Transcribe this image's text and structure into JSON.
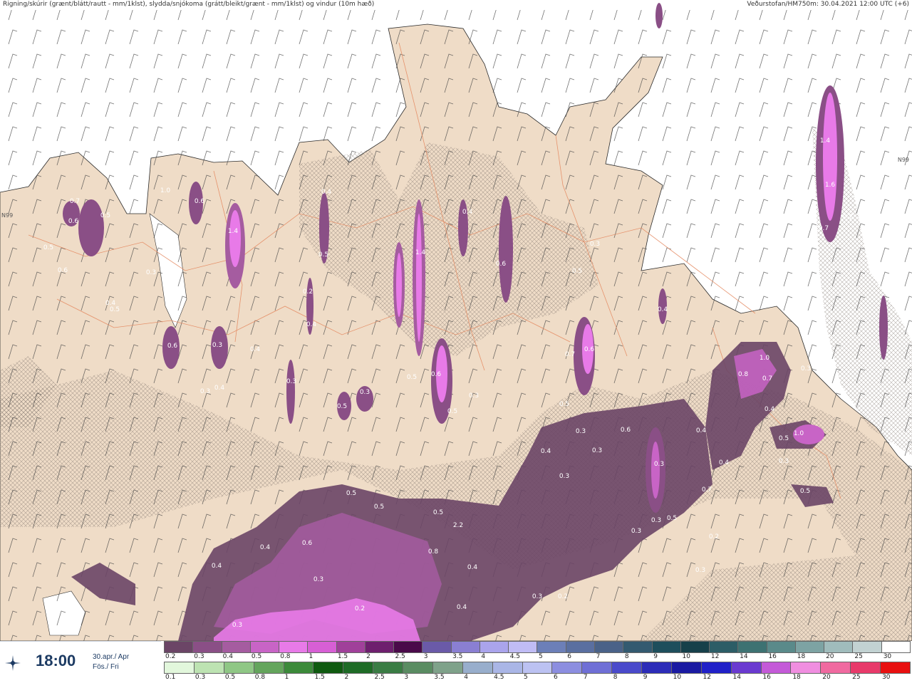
{
  "header": {
    "left_text": "Rigning/skúrir (grænt/blátt/rautt - mm/1klst), slydda/snjókoma (grátt/bleikt/grænt - mm/1klst) og vindur (10m hæð)",
    "right_text": "Veðurstofan/HM750m: 30.04.2021 12:00 UTC (+6)"
  },
  "lat_labels": {
    "left": "N99",
    "right": "N99"
  },
  "time_panel": {
    "time": "18:00",
    "date_line1": "30.apr./ Apr",
    "date_line2": "Fös./ Fri",
    "icon": "sun-compass-icon"
  },
  "precip_labels": [
    "0.7",
    "0.5",
    "0.6",
    "0.5",
    "0.6",
    "1.0",
    "0.6",
    "1.4",
    "0.3",
    "0.4",
    "0.3",
    "0.4",
    "1.4",
    "0.4",
    "0.5",
    "0.2",
    "0.4",
    "0.6",
    "0.5",
    "0.3",
    "0.3",
    "0.5",
    "0.5",
    "0.6",
    "0.5",
    "0.3",
    "0.6",
    "0.5",
    "0.3",
    "0.4",
    "0.3",
    "0.4",
    "0.7",
    "0.8",
    "1.0",
    "0.7",
    "0.3",
    "1.4",
    "1.6",
    "0.2",
    "0.7",
    "0.4",
    "1.0",
    "0.5",
    "0.3",
    "0.5",
    "0.2",
    "0.3",
    "0.4",
    "0.6",
    "0.5",
    "0.3",
    "0.4",
    "0.3",
    "0.4",
    "0.6",
    "0.3",
    "0.4",
    "0.7",
    "0.3",
    "0.5",
    "0.3",
    "0.3",
    "2.2",
    "0.8",
    "0.4",
    "0.4",
    "0.3",
    "0.2",
    "0.2",
    "0.3",
    "0.5",
    "0.6",
    "0.4",
    "0.4",
    "0.3",
    "0.5",
    "0.5"
  ],
  "scale_rain": {
    "labels": [
      "0.2",
      "0.3",
      "0.4",
      "0.5",
      "0.8",
      "1",
      "1.5",
      "2",
      "2.5",
      "3",
      "3.5",
      "4",
      "4.5",
      "5",
      "6",
      "7",
      "8",
      "9",
      "10",
      "12",
      "14",
      "16",
      "18",
      "20",
      "25",
      "30"
    ],
    "colors": [
      "#6b4566",
      "#8a4f86",
      "#a55ca0",
      "#c864c6",
      "#e87ae8",
      "#d75fd5",
      "#a0409a",
      "#6e1f6e",
      "#4a0a4a",
      "#6a5aa8",
      "#8a7fd2",
      "#aaa4ec",
      "#c0bcf5",
      "#6c7fb8",
      "#5a6fa0",
      "#4a6288",
      "#335a70",
      "#1e4e5c",
      "#16404a",
      "#2c5d66",
      "#3d7272",
      "#5a8a8a",
      "#7da3a3",
      "#a0bcbc",
      "#c2d2d2",
      "#ffffff"
    ]
  },
  "scale_snow": {
    "labels": [
      "0.1",
      "0.3",
      "0.5",
      "0.8",
      "1",
      "1.5",
      "2",
      "2.5",
      "3",
      "3.5",
      "4",
      "4.5",
      "5",
      "6",
      "7",
      "8",
      "9",
      "10",
      "12",
      "14",
      "16",
      "18",
      "20",
      "25",
      "30"
    ],
    "colors": [
      "#e2f7dc",
      "#bde3b2",
      "#8fc785",
      "#64a55c",
      "#3c8a3a",
      "#0f5a10",
      "#1e6b26",
      "#3a7c44",
      "#5a8c62",
      "#7fa28a",
      "#98aecc",
      "#aab6e6",
      "#bcc2f2",
      "#8c8ee0",
      "#6f6fd6",
      "#4a4acb",
      "#2c2cb8",
      "#1a1aa2",
      "#2020c8",
      "#6a3ad0",
      "#c45ad8",
      "#f08ee0",
      "#f06aa0",
      "#e83a6a",
      "#e81010"
    ]
  }
}
